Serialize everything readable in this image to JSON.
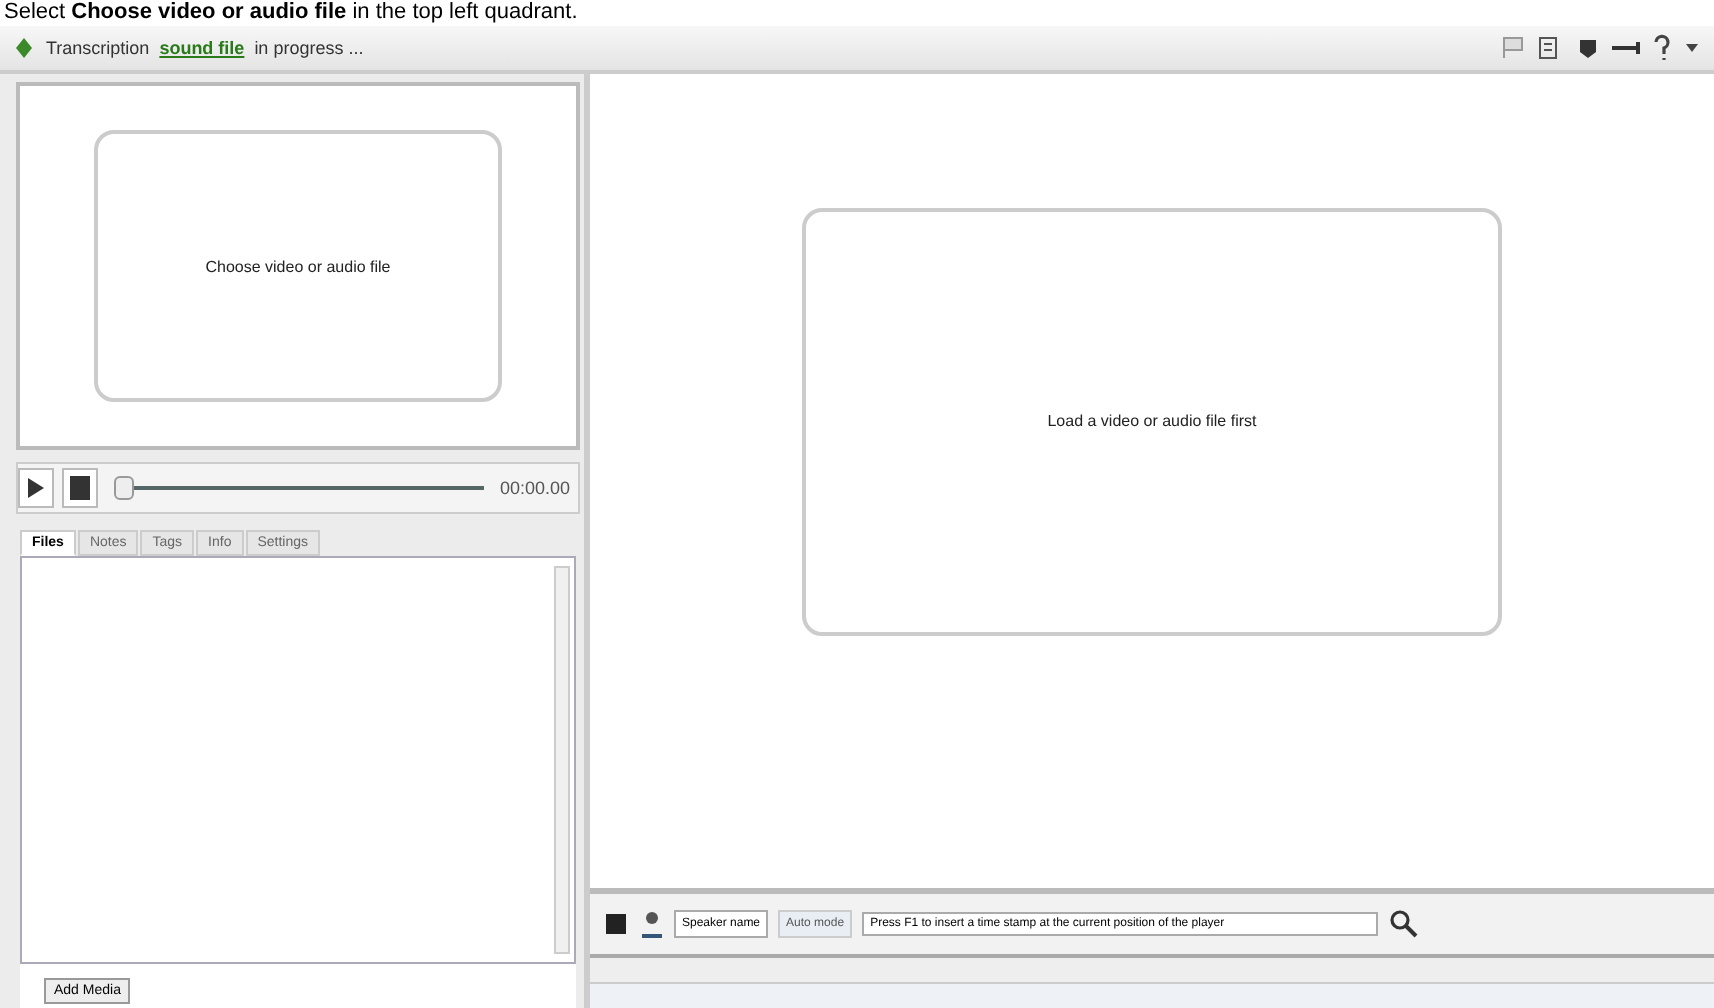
{
  "caption": "Select **Choose video or audio file** in the top left quadrant.",
  "toolbar": {
    "title": "Transcription",
    "link": "sound file",
    "info": "in progress ..."
  },
  "video_panel": {
    "prompt": "Choose video or audio file"
  },
  "player": {
    "time": "00:00.00",
    "level": 0.0
  },
  "tabs": [
    {
      "label": "Files",
      "selected": true
    },
    {
      "label": "Notes",
      "selected": false
    },
    {
      "label": "Tags",
      "selected": false
    },
    {
      "label": "Info",
      "selected": false
    },
    {
      "label": "Settings",
      "selected": false
    }
  ],
  "add_button": "Add Media",
  "document_panel": {
    "prompt": "Load a video or audio file first"
  },
  "editor_bar": {
    "speaker": "Speaker name",
    "mode": "Auto mode",
    "hint": "Press F1 to insert a time stamp at the current position of the player"
  }
}
